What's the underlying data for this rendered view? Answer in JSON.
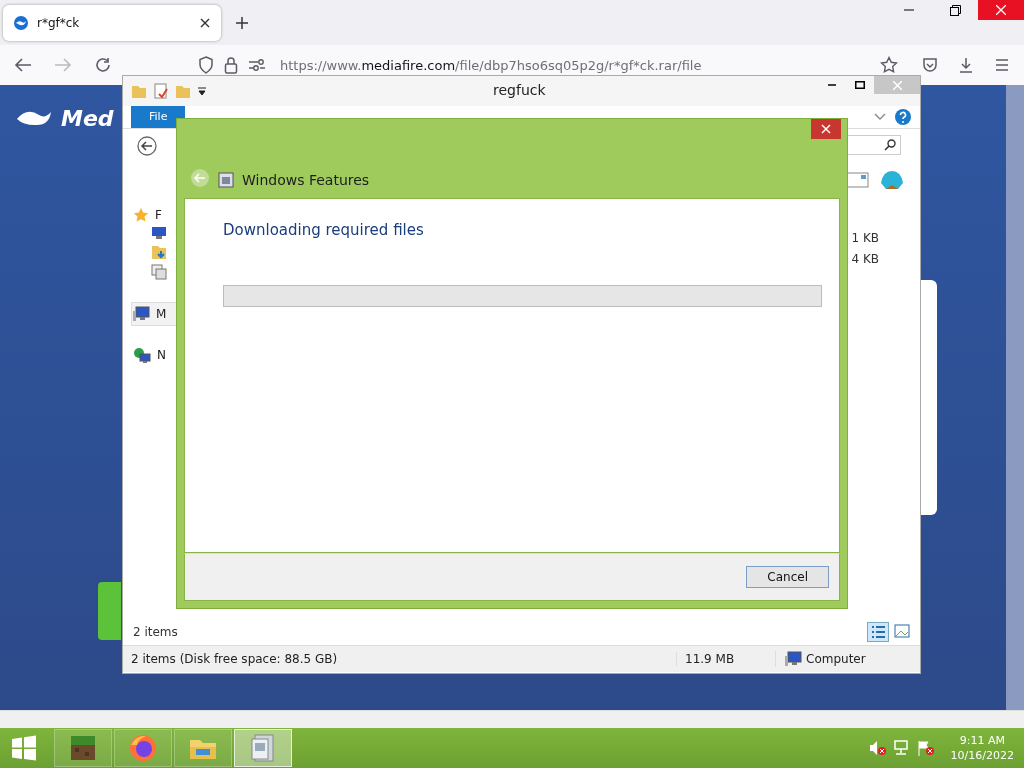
{
  "browser": {
    "tabs": [
      {
        "label": "r*gf*ck",
        "selected": true
      }
    ],
    "url": {
      "prefix": "https://www.",
      "domain": "mediafire.com",
      "path": "/file/dbp7hso6sq05p2g/r*gf*ck.rar/file"
    },
    "page": {
      "logo": "Med"
    }
  },
  "explorer": {
    "title": "regfuck",
    "ribbon_tabs": [
      {
        "label": "File",
        "selected": true
      }
    ],
    "nav_items": [
      {
        "label": "F",
        "kind": "favorites",
        "selected": false
      },
      {
        "label": "M",
        "kind": "computer",
        "selected": true
      },
      {
        "label": "N",
        "kind": "network",
        "selected": false
      }
    ],
    "sizes": [
      "1 KB",
      "4 KB"
    ],
    "item_count": "2 items",
    "status_bar": {
      "summary": "2 items (Disk free space: 88.5 GB)",
      "size": "11.9 MB",
      "location": "Computer"
    }
  },
  "dialog": {
    "title": "Windows Features",
    "heading": "Downloading required files",
    "progress": {
      "level": 0
    },
    "buttons": [
      "Cancel"
    ]
  },
  "taskbar": {
    "apps": [
      {
        "kind": "minecraft",
        "selected": false
      },
      {
        "kind": "firefox",
        "selected": false
      },
      {
        "kind": "explorer",
        "selected": false
      },
      {
        "kind": "features",
        "selected": true
      }
    ],
    "time": "9:11 AM",
    "date": "10/16/2022"
  }
}
